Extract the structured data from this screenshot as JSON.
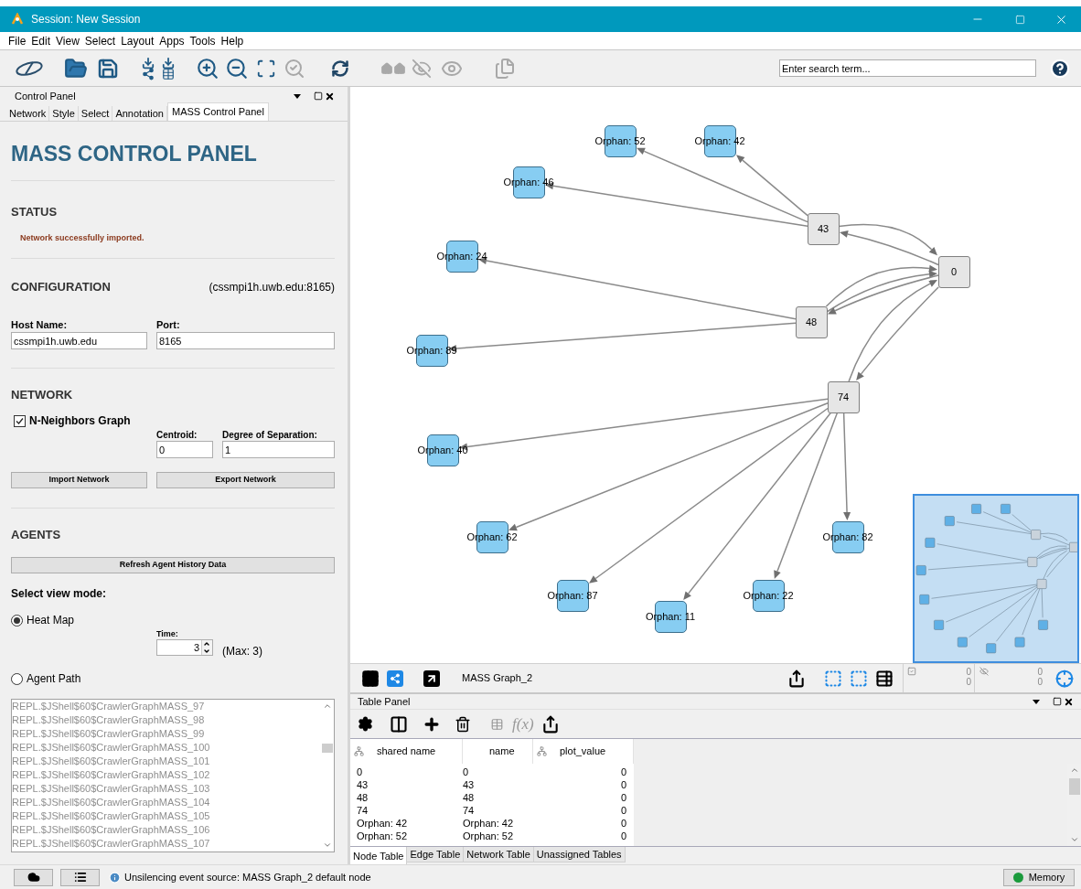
{
  "window": {
    "title": "Session: New Session"
  },
  "menu": [
    "File",
    "Edit",
    "View",
    "Select",
    "Layout",
    "Apps",
    "Tools",
    "Help"
  ],
  "search": {
    "placeholder": "Enter search term..."
  },
  "control_panel": {
    "title": "Control Panel",
    "tabs": [
      {
        "label": "Network",
        "selected": false
      },
      {
        "label": "Style",
        "selected": false
      },
      {
        "label": "Select",
        "selected": false
      },
      {
        "label": "Annotation",
        "selected": false
      },
      {
        "label": "MASS Control Panel",
        "selected": true
      }
    ],
    "heading": "MASS CONTROL PANEL",
    "status": {
      "heading": "STATUS",
      "message": "Network successfully imported."
    },
    "configuration": {
      "heading": "CONFIGURATION",
      "server": "(cssmpi1h.uwb.edu:8165)",
      "host_label": "Host Name:",
      "host_value": "cssmpi1h.uwb.edu",
      "port_label": "Port:",
      "port_value": "8165"
    },
    "network": {
      "heading": "NETWORK",
      "n_neighbors": {
        "label": "N-Neighbors Graph",
        "checked": true
      },
      "centroid_label": "Centroid:",
      "centroid_value": "0",
      "separation_label": "Degree of Separation:",
      "separation_value": "1",
      "buttons": [
        "Import Network",
        "Export Network"
      ]
    },
    "agents": {
      "heading": "AGENTS",
      "refresh_button": "Refresh Agent History Data",
      "view_mode_label": "Select view mode:",
      "modes": [
        {
          "label": "Heat Map",
          "selected": true
        },
        {
          "label": "Agent Path",
          "selected": false
        }
      ],
      "time_label": "Time:",
      "time_value": "3",
      "max": "(Max: 3)",
      "agent_list": [
        "REPL.$JShell$60$CrawlerGraphMASS_97",
        "REPL.$JShell$60$CrawlerGraphMASS_98",
        "REPL.$JShell$60$CrawlerGraphMASS_99",
        "REPL.$JShell$60$CrawlerGraphMASS_100",
        "REPL.$JShell$60$CrawlerGraphMASS_101",
        "REPL.$JShell$60$CrawlerGraphMASS_102",
        "REPL.$JShell$60$CrawlerGraphMASS_103",
        "REPL.$JShell$60$CrawlerGraphMASS_104",
        "REPL.$JShell$60$CrawlerGraphMASS_105",
        "REPL.$JShell$60$CrawlerGraphMASS_106",
        "REPL.$JShell$60$CrawlerGraphMASS_107"
      ]
    }
  },
  "graph": {
    "nodes": [
      {
        "label": "Orphan: 52",
        "kind": "orphan"
      },
      {
        "label": "Orphan: 42",
        "kind": "orphan"
      },
      {
        "label": "Orphan: 46",
        "kind": "orphan"
      },
      {
        "label": "43",
        "kind": "hub"
      },
      {
        "label": "0",
        "kind": "hub"
      },
      {
        "label": "Orphan: 24",
        "kind": "orphan"
      },
      {
        "label": "48",
        "kind": "hub"
      },
      {
        "label": "Orphan: 89",
        "kind": "orphan"
      },
      {
        "label": "74",
        "kind": "hub"
      },
      {
        "label": "Orphan: 40",
        "kind": "orphan"
      },
      {
        "label": "Orphan: 62",
        "kind": "orphan"
      },
      {
        "label": "Orphan: 82",
        "kind": "orphan"
      },
      {
        "label": "Orphan: 87",
        "kind": "orphan"
      },
      {
        "label": "Orphan: 22",
        "kind": "orphan"
      },
      {
        "label": "Orphan: 11",
        "kind": "orphan"
      }
    ],
    "network_name": "MASS Graph_2",
    "selected_counts": [
      "0",
      "0"
    ],
    "hidden_counts": [
      "0",
      "0"
    ]
  },
  "table_panel": {
    "title": "Table Panel",
    "function_label": "f(x)",
    "columns": [
      {
        "label": "shared name",
        "shared": true
      },
      {
        "label": "name",
        "shared": false
      },
      {
        "label": "plot_value",
        "shared": true
      }
    ],
    "rows": [
      [
        "0",
        "0",
        "0"
      ],
      [
        "43",
        "43",
        "0"
      ],
      [
        "48",
        "48",
        "0"
      ],
      [
        "74",
        "74",
        "0"
      ],
      [
        "Orphan: 42",
        "Orphan: 42",
        "0"
      ],
      [
        "Orphan: 52",
        "Orphan: 52",
        "0"
      ]
    ],
    "tabs": [
      {
        "label": "Node Table",
        "selected": true
      },
      {
        "label": "Edge Table",
        "selected": false
      },
      {
        "label": "Network Table",
        "selected": false
      },
      {
        "label": "Unassigned Tables",
        "selected": false
      }
    ]
  },
  "status_bar": {
    "message": "Unsilencing event source: MASS Graph_2 default node",
    "memory_button": "Memory"
  }
}
